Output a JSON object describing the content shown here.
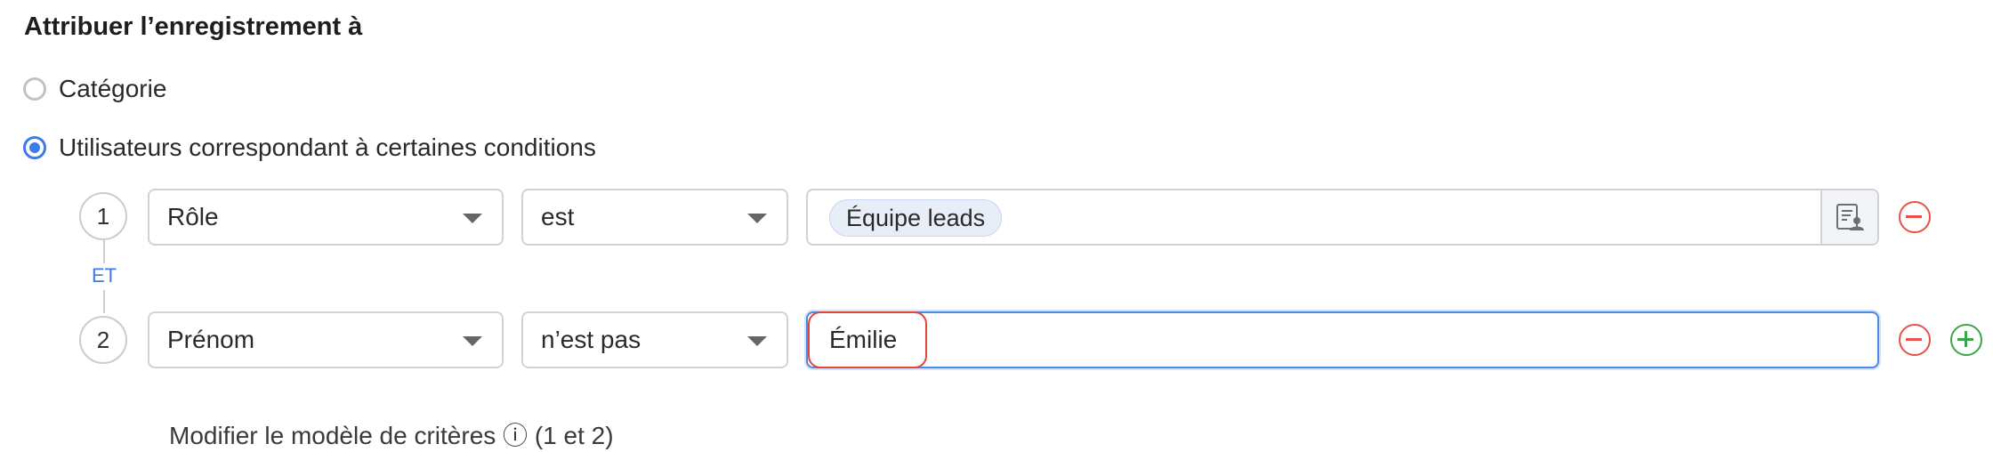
{
  "section_title": "Attribuer l’enregistrement à",
  "options": {
    "category": "Catégorie",
    "users_matching": "Utilisateurs correspondant à certaines conditions"
  },
  "selected_option": "users_matching",
  "conditions": [
    {
      "index": "1",
      "field": "Rôle",
      "operator": "est",
      "value_chip": "Équipe leads"
    },
    {
      "index": "2",
      "field": "Prénom",
      "operator": "n’est pas",
      "value_text": "Émilie"
    }
  ],
  "connector_label": "ET",
  "footer_text": "Modifier le modèle de critères  ⓘ   (1 et 2)",
  "colors": {
    "accent": "#3d7be6",
    "remove": "#e8504a",
    "add": "#3aa64a",
    "error_highlight": "#e0463a"
  },
  "icons": {
    "lookup": "user-list-icon",
    "remove": "minus-circle-icon",
    "add": "plus-circle-icon"
  }
}
